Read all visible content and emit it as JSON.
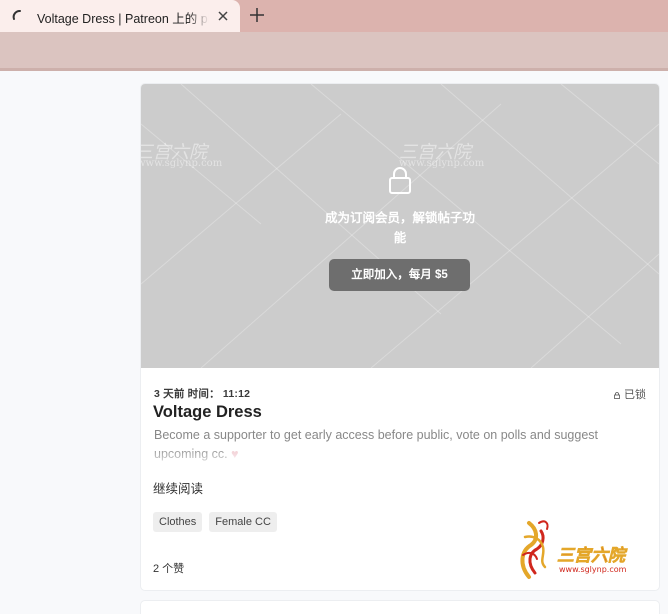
{
  "browser": {
    "tab_title": "Voltage Dress | Patreon 上的 plbo",
    "new_tab_symbol": "+"
  },
  "post": {
    "locked_message": "成为订阅会员，解锁帖子功能",
    "join_button": "立即加入，每月 $5",
    "meta": "3 天前 时间： 11:12",
    "lock_status": "已锁",
    "title": "Voltage Dress",
    "teaser_text": "Become a supporter to get early access before public, vote on polls and suggest upcoming cc.",
    "teaser_emoji": "♥",
    "read_more": "继续阅读",
    "tags": [
      "Clothes",
      "Female CC"
    ],
    "likes": "2 个赞"
  },
  "watermark": {
    "name": "三宫六院",
    "url": "www.sglynp.com"
  },
  "colors": {
    "tab_strip": "#dcb3ae",
    "active_tab": "#fbeeec",
    "toolbar": "#dbc4c0",
    "locked_overlay": "#cccccc",
    "join_button": "#6e6e6e",
    "logo_red": "#d0271d",
    "logo_gold": "#e4a72a"
  }
}
